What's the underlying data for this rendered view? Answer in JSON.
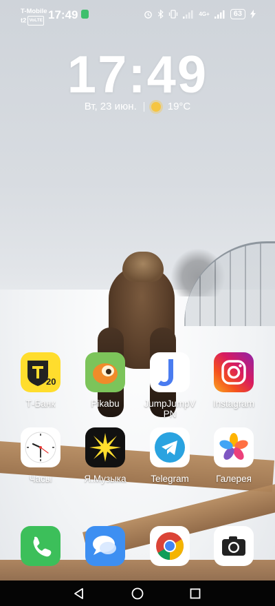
{
  "status_bar": {
    "carrier_line1": "T-Mobile",
    "carrier_line2": "t2",
    "volte_badge": "VoLTE",
    "time": "17:49",
    "network": "4G+",
    "battery": "63"
  },
  "lockclock": {
    "time": "17:49",
    "date": "Вт, 23 июн.",
    "temperature": "19°C"
  },
  "apps_row1": [
    {
      "label": "Т-Банк"
    },
    {
      "label": "Pikabu"
    },
    {
      "label": "JumpJumpVPN"
    },
    {
      "label": "Instagram"
    }
  ],
  "apps_row2": [
    {
      "label": "Часы"
    },
    {
      "label": "Я.Музыка"
    },
    {
      "label": "Telegram"
    },
    {
      "label": "Галерея"
    }
  ],
  "tbank_logo_text": "20",
  "colors": {
    "tbank": "#ffdd2d",
    "pikabu": "#7cc45a",
    "telegram": "#2aa3e0",
    "phone": "#3cbf5a",
    "messages": "#3d8ff2",
    "navbar": "#050505"
  }
}
